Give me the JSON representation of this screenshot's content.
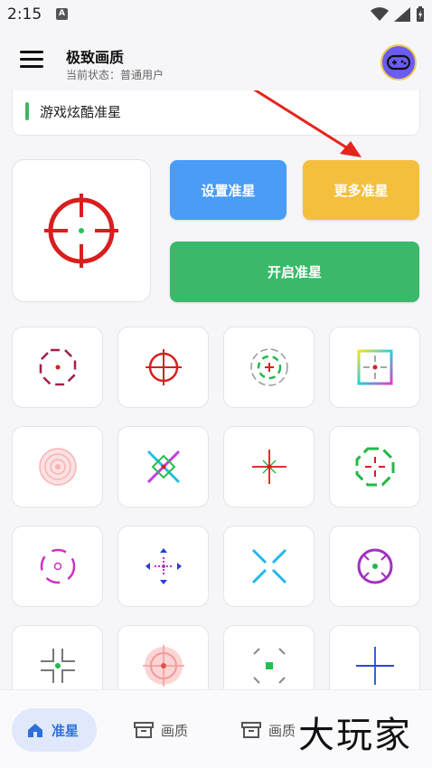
{
  "status_bar": {
    "time": "2:15",
    "badge": "A"
  },
  "app_bar": {
    "title": "极致画质",
    "subtitle": "当前状态：普通用户"
  },
  "notice": {
    "text": "游戏炫酷准星"
  },
  "buttons": {
    "set": "设置准星",
    "more": "更多准星",
    "open": "开启准星"
  },
  "colors": {
    "blue": "#4a9cf7",
    "yellow": "#f5bf3e",
    "green": "#3bb96a",
    "accent": "#2f6fdb"
  },
  "grid_icons": [
    "octagon-dot-crosshair-icon",
    "circle-cross-crosshair-icon",
    "dashed-ring-crosshair-icon",
    "gradient-square-crosshair-icon",
    "pink-rings-crosshair-icon",
    "x-diamond-crosshair-icon",
    "red-star-crosshair-icon",
    "green-octagon-crosshair-icon",
    "magenta-ring-crosshair-icon",
    "blue-arrows-crosshair-icon",
    "cyan-x-crosshair-icon",
    "purple-circle-crosshair-icon",
    "gray-plus-crosshair-icon",
    "red-glow-crosshair-icon",
    "green-square-crosshair-icon",
    "blue-plus-crosshair-icon"
  ],
  "bottom_nav": {
    "home": "准星",
    "quality": "画质",
    "quality2": "画质"
  },
  "watermark": "大玩家"
}
